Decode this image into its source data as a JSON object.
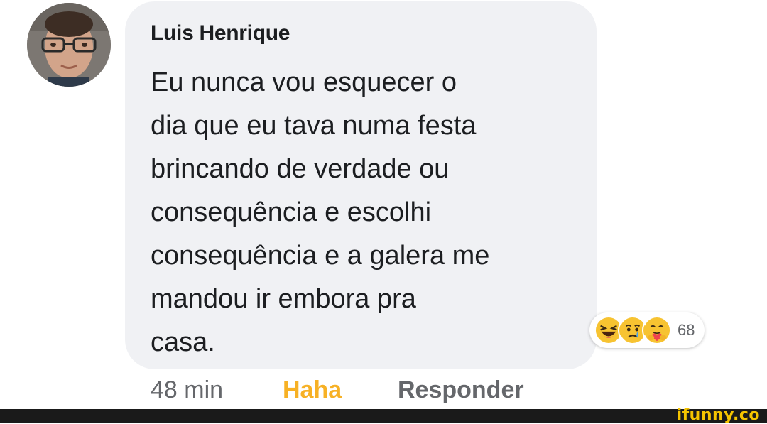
{
  "comment": {
    "author": "Luis Henrique",
    "text_lines": [
      "Eu nunca vou esquecer o",
      "dia que eu tava numa festa",
      "brincando de verdade ou",
      "consequência e escolhi",
      "consequência e a galera me",
      "mandou ir embora pra",
      "casa."
    ],
    "reactions": {
      "icons": [
        "haha-emoji-icon",
        "sad-emoji-icon",
        "care-emoji-icon"
      ],
      "count": "68"
    },
    "meta": {
      "time": "48 min",
      "reaction_label": "Haha",
      "reply_label": "Responder"
    }
  },
  "watermark": "ifunny.co",
  "colors": {
    "bubble": "#f0f1f4",
    "haha": "#f7b125",
    "meta_gray": "#65676b"
  }
}
